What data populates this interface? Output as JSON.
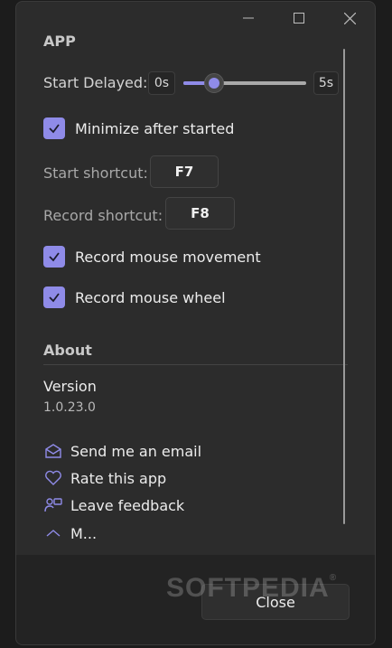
{
  "window": {
    "minimize_icon": "minimize-icon",
    "maximize_icon": "maximize-icon",
    "close_icon": "close-icon"
  },
  "app_section": {
    "title": "APP",
    "start_delayed": {
      "label": "Start Delayed:",
      "min_label": "0s",
      "max_label": "5s",
      "value_fraction": 0.25
    },
    "minimize_after_started": {
      "label": "Minimize after started",
      "checked": true
    },
    "start_shortcut": {
      "label": "Start shortcut:",
      "key": "F7"
    },
    "record_shortcut": {
      "label": "Record shortcut:",
      "key": "F8"
    },
    "record_mouse_movement": {
      "label": "Record mouse movement",
      "checked": true
    },
    "record_mouse_wheel": {
      "label": "Record mouse wheel",
      "checked": true
    }
  },
  "about_section": {
    "title": "About",
    "version_label": "Version",
    "version_value": "1.0.23.0",
    "links": [
      {
        "icon": "mail-icon",
        "label": "Send me an email"
      },
      {
        "icon": "heart-icon",
        "label": "Rate this app"
      },
      {
        "icon": "feedback-icon",
        "label": "Leave feedback"
      },
      {
        "icon": "chevron-up-icon",
        "label": "M..."
      }
    ]
  },
  "footer": {
    "close_label": "Close",
    "watermark": "SOFTPEDIA"
  },
  "colors": {
    "accent": "#8f8be8",
    "background": "#2c2c2c",
    "footer": "#232323"
  }
}
